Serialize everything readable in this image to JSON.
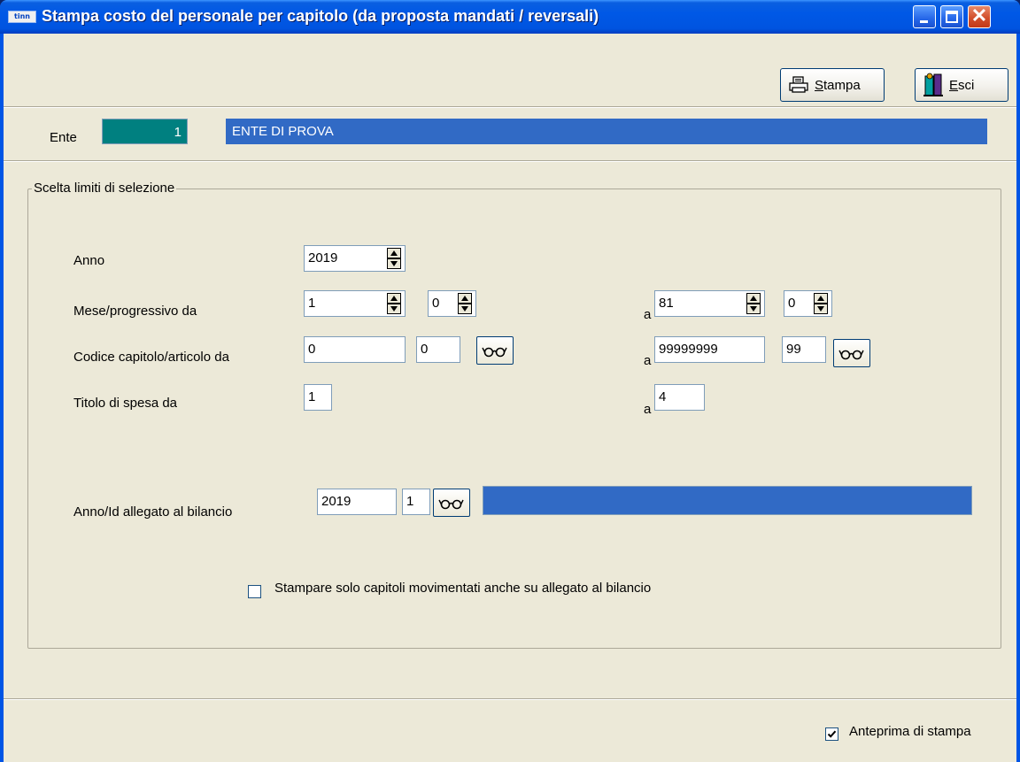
{
  "window": {
    "title": "Stampa costo del personale per capitolo (da proposta mandati / reversali)",
    "app_icon_text": "tinn"
  },
  "toolbar": {
    "print_label_mnemonic": "S",
    "print_label_rest": "tampa",
    "exit_label_mnemonic": "E",
    "exit_label_rest": "sci"
  },
  "ente": {
    "label": "Ente",
    "code": "1",
    "name": "ENTE DI PROVA"
  },
  "selection": {
    "group_title": "Scelta limiti di selezione",
    "anno_label": "Anno",
    "anno_value": "2019",
    "mese_label": "Mese/progressivo da",
    "mese_da": "1",
    "progressivo_da": "0",
    "a_label": "a",
    "mese_a": "81",
    "progressivo_a": "0",
    "codice_label": "Codice capitolo/articolo da",
    "capitolo_da": "0",
    "articolo_da": "0",
    "capitolo_a": "99999999",
    "articolo_a": "99",
    "titolo_label": "Titolo di spesa da",
    "titolo_da": "1",
    "titolo_a": "4",
    "allegato_label": "Anno/Id allegato al bilancio",
    "allegato_anno": "2019",
    "allegato_id": "1",
    "allegato_desc": "",
    "solo_capitoli_label": "Stampare solo capitoli movimentati anche su allegato al bilancio",
    "solo_capitoli_checked": false
  },
  "footer": {
    "anteprima_label": "Anteprima di stampa",
    "anteprima_checked": true
  },
  "icons": {
    "lookup": "glasses-icon",
    "print": "printer-icon",
    "exit": "exit-door-icon"
  },
  "colors": {
    "titlebar": "#0054e3",
    "ente_code_bg": "#008080",
    "ente_name_bg": "#316ac5",
    "face": "#ece9d8"
  }
}
